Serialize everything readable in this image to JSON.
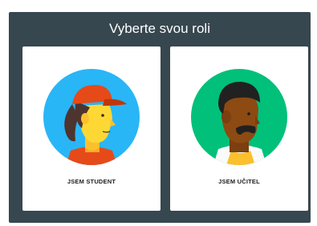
{
  "dialog": {
    "title": "Vyberte svou roli"
  },
  "roles": [
    {
      "label": "JSEM STUDENT",
      "icon": "student-avatar-icon",
      "color": "#29b6f6"
    },
    {
      "label": "JSEM UČITEL",
      "icon": "teacher-avatar-icon",
      "color": "#00c07a"
    }
  ]
}
